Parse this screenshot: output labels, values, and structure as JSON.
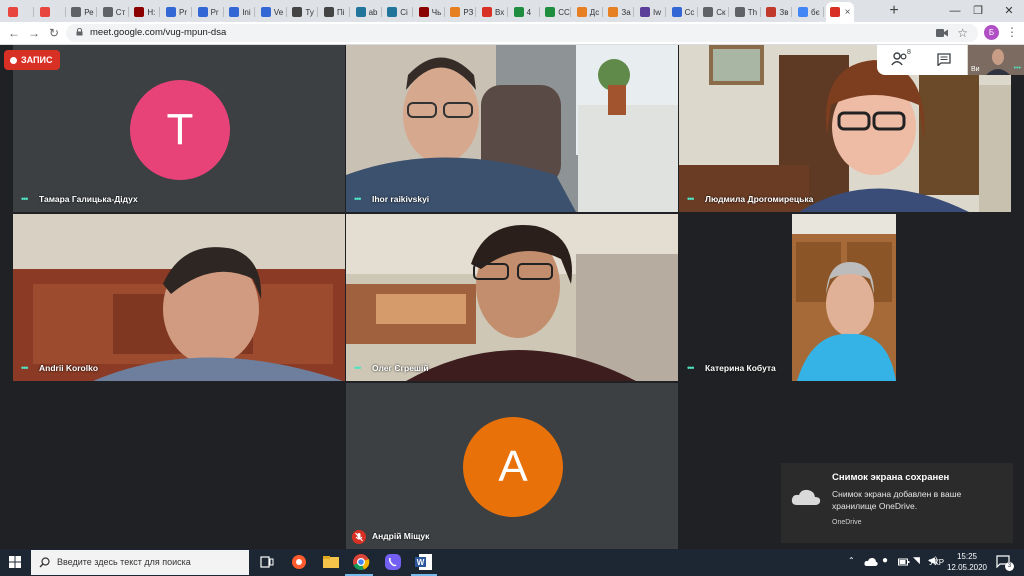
{
  "browser": {
    "tabs": [
      {
        "label": "",
        "color": "#e8453c"
      },
      {
        "label": "",
        "color": "#e8453c"
      },
      {
        "label": "Ре",
        "color": "#5f6368"
      },
      {
        "label": "Ст",
        "color": "#5f6368"
      },
      {
        "label": "Н:",
        "color": "#8b0000"
      },
      {
        "label": "Pr",
        "color": "#3367d6"
      },
      {
        "label": "Pr",
        "color": "#3367d6"
      },
      {
        "label": "Ini",
        "color": "#3367d6"
      },
      {
        "label": "Ve",
        "color": "#3367d6"
      },
      {
        "label": "Ty",
        "color": "#444"
      },
      {
        "label": "Пі",
        "color": "#444"
      },
      {
        "label": "ab",
        "color": "#21759b"
      },
      {
        "label": "Ci",
        "color": "#21759b"
      },
      {
        "label": "Чь",
        "color": "#8b0000"
      },
      {
        "label": "РЗ",
        "color": "#e67e22"
      },
      {
        "label": "Вх",
        "color": "#d93025"
      },
      {
        "label": "4",
        "color": "#1e8e3e"
      },
      {
        "label": "CC",
        "color": "#1e8e3e"
      },
      {
        "label": "Дс",
        "color": "#e67e22"
      },
      {
        "label": "За",
        "color": "#e67e22"
      },
      {
        "label": "Iw",
        "color": "#5b3e99"
      },
      {
        "label": "Сс",
        "color": "#3367d6"
      },
      {
        "label": "Ск",
        "color": "#5f6368"
      },
      {
        "label": "Th",
        "color": "#5f6368"
      },
      {
        "label": "Зв",
        "color": "#c0392b"
      },
      {
        "label": "бє",
        "color": "#4285f4"
      },
      {
        "label": "",
        "color": "#d93025",
        "active": true
      }
    ],
    "new_tab": "+",
    "url": "meet.google.com/vug-mpun-dsa",
    "profile_initial": "Б"
  },
  "meet": {
    "recording_label": "ЗАПИС",
    "people_count": "8",
    "self_label": "Ви",
    "participants": [
      {
        "name": "Тамара Галицька-Дідух",
        "avatar": "T",
        "avatar_color": "#e84378"
      },
      {
        "name": "Ihor raikivskyi"
      },
      {
        "name": "Людмила Дрогомирецька"
      },
      {
        "name": "Andrii Korolko"
      },
      {
        "name": "Олег Єгрешій"
      },
      {
        "name": "Катерина Кобута"
      },
      {
        "name": "Андрій Міщук",
        "avatar": "A",
        "avatar_color": "#e8710a"
      }
    ]
  },
  "notification": {
    "title": "Снимок экрана сохранен",
    "body": "Снимок экрана добавлен в ваше хранилище OneDrive.",
    "source": "OneDrive"
  },
  "taskbar": {
    "search_placeholder": "Введите здесь текст для поиска",
    "language": "УКР",
    "time": "15:25",
    "date": "12.05.2020",
    "notification_count": "3"
  }
}
